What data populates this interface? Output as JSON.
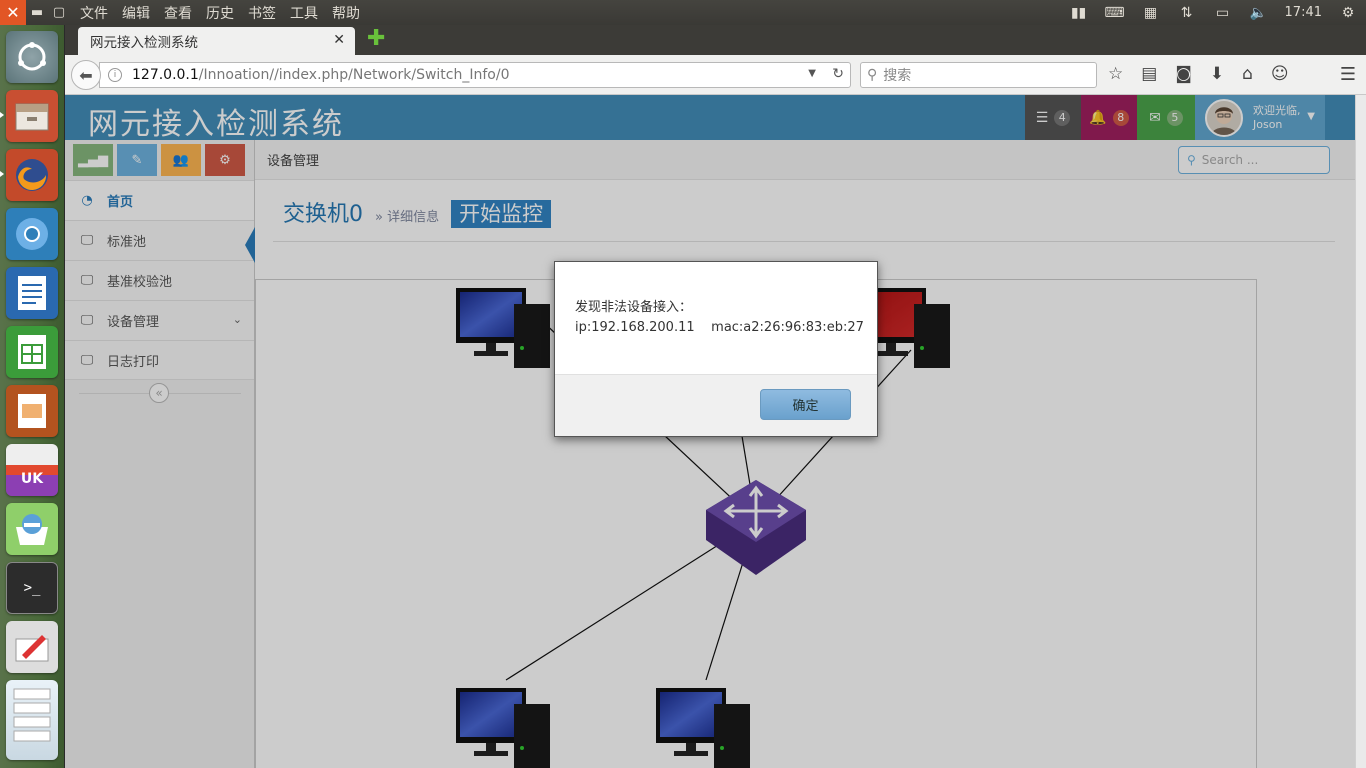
{
  "top_panel": {
    "menu": [
      "文件",
      "编辑",
      "查看",
      "历史",
      "书签",
      "工具",
      "帮助"
    ],
    "clock": "17:41"
  },
  "browser": {
    "tab_title": "网元接入检测系统",
    "url_host": "127.0.0.1",
    "url_path": "/Innoation//index.php/Network/Switch_Info/0",
    "search_placeholder": "搜索"
  },
  "app": {
    "title": "网元接入检测系统",
    "tasks_count": "4",
    "notifications_count": "8",
    "messages_count": "5",
    "user_greeting": "欢迎光临,",
    "user_name": "Joson",
    "search_placeholder": "Search ...",
    "breadcrumb": "设备管理",
    "colors": {
      "header": "#438eb9",
      "tasks": "#555555",
      "notifications": "#a0a0a0",
      "messages": "#6fb3e0",
      "accent": "#2679b5"
    }
  },
  "sidebar": {
    "items": [
      {
        "label": "首页",
        "icon": "dashboard-icon"
      },
      {
        "label": "标准池",
        "icon": "desktop-icon"
      },
      {
        "label": "基准校验池",
        "icon": "desktop-icon"
      },
      {
        "label": "设备管理",
        "icon": "desktop-icon"
      },
      {
        "label": "日志打印",
        "icon": "desktop-icon"
      }
    ]
  },
  "page_header": {
    "title": "交换机0",
    "subtitle": "详细信息",
    "start_button": "开始监控"
  },
  "topology": {
    "nodes": [
      "pc-top-left",
      "pc-top-right-alert",
      "switch-center",
      "pc-bottom-left",
      "pc-bottom-right"
    ]
  },
  "modal": {
    "line1": "发现非法设备接入：",
    "line2": "ip:192.168.200.11    mac:a2:26:96:83:eb:27",
    "ok_label": "确定"
  }
}
